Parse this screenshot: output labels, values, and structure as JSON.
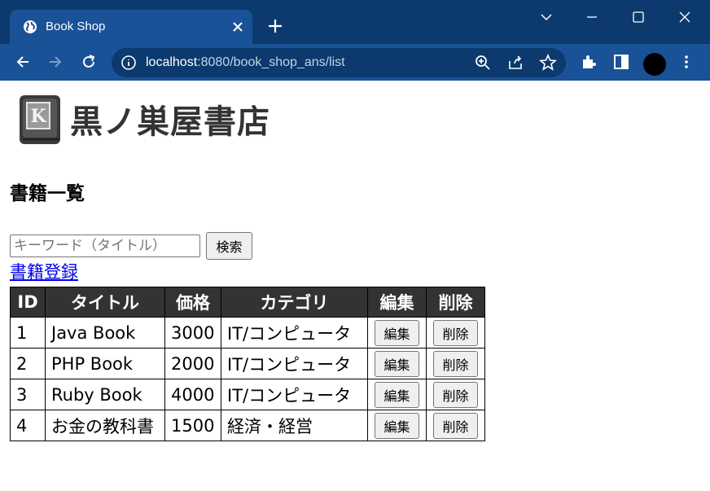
{
  "browser": {
    "tab_title": "Book Shop",
    "url_host": "localhost",
    "url_path": ":8080/book_shop_ans/list",
    "accent": "#1a5297"
  },
  "page": {
    "logo_letter": "K",
    "logo_text": "黒ノ巣屋書店",
    "heading": "書籍一覧",
    "search": {
      "placeholder": "キーワード（タイトル）",
      "value": "",
      "button_label": "検索"
    },
    "register_link": "書籍登録",
    "table": {
      "headers": [
        "ID",
        "タイトル",
        "価格",
        "カテゴリ",
        "編集",
        "削除"
      ],
      "rows": [
        {
          "id": "1",
          "title": "Java Book",
          "price": "3000",
          "category": "IT/コンピュータ",
          "edit": "編集",
          "delete": "削除"
        },
        {
          "id": "2",
          "title": "PHP Book",
          "price": "2000",
          "category": "IT/コンピュータ",
          "edit": "編集",
          "delete": "削除"
        },
        {
          "id": "3",
          "title": "Ruby Book",
          "price": "4000",
          "category": "IT/コンピュータ",
          "edit": "編集",
          "delete": "削除"
        },
        {
          "id": "4",
          "title": "お金の教科書",
          "price": "1500",
          "category": "経済・経営",
          "edit": "編集",
          "delete": "削除"
        }
      ]
    }
  }
}
